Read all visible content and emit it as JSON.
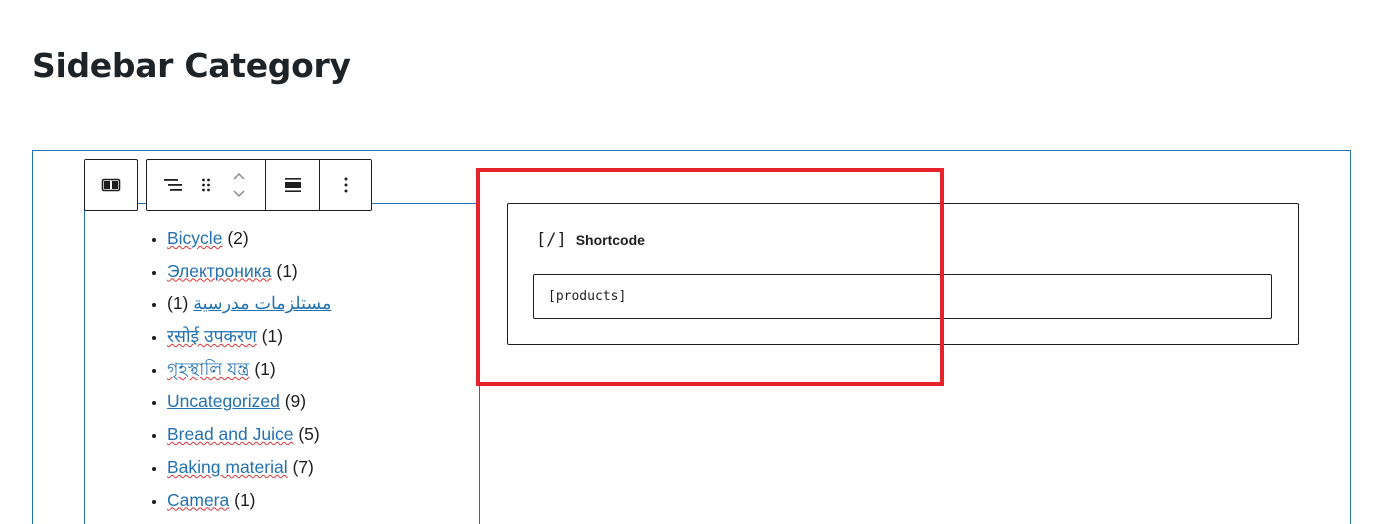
{
  "page": {
    "title": "Sidebar Category"
  },
  "toolbar": {
    "buttons": [
      {
        "icon": "columns-icon"
      },
      {
        "icon": "list-view-icon"
      },
      {
        "icon": "drag-handle-icon"
      },
      {
        "icon": "move-up-down-icon"
      },
      {
        "icon": "align-icon"
      },
      {
        "icon": "more-options-icon"
      }
    ]
  },
  "categories": [
    {
      "name": "Bicycle",
      "count": "(2)",
      "spell_error": true
    },
    {
      "name": "Электроника",
      "count": "(1)",
      "spell_error": true
    },
    {
      "name": "مستلزمات مدرسية",
      "count": "(1)",
      "spell_error": false,
      "rtl": true
    },
    {
      "name": "रसोई उपकरण",
      "count": "(1)",
      "spell_error": true
    },
    {
      "name": "গৃহস্থালি যন্ত্র",
      "count": "(1)",
      "spell_error": true
    },
    {
      "name": "Uncategorized",
      "count": "(9)",
      "spell_error": false
    },
    {
      "name": "Bread and Juice",
      "count": "(5)",
      "spell_error": true
    },
    {
      "name": "Baking material",
      "count": "(7)",
      "spell_error": true
    },
    {
      "name": "Camera",
      "count": "(1)",
      "spell_error": true
    }
  ],
  "shortcode": {
    "icon": "[/]",
    "label": "Shortcode",
    "value": "[products]"
  },
  "colors": {
    "accent": "#2271b1",
    "highlight": "#e8222a",
    "spellcheck": "#d63638"
  }
}
